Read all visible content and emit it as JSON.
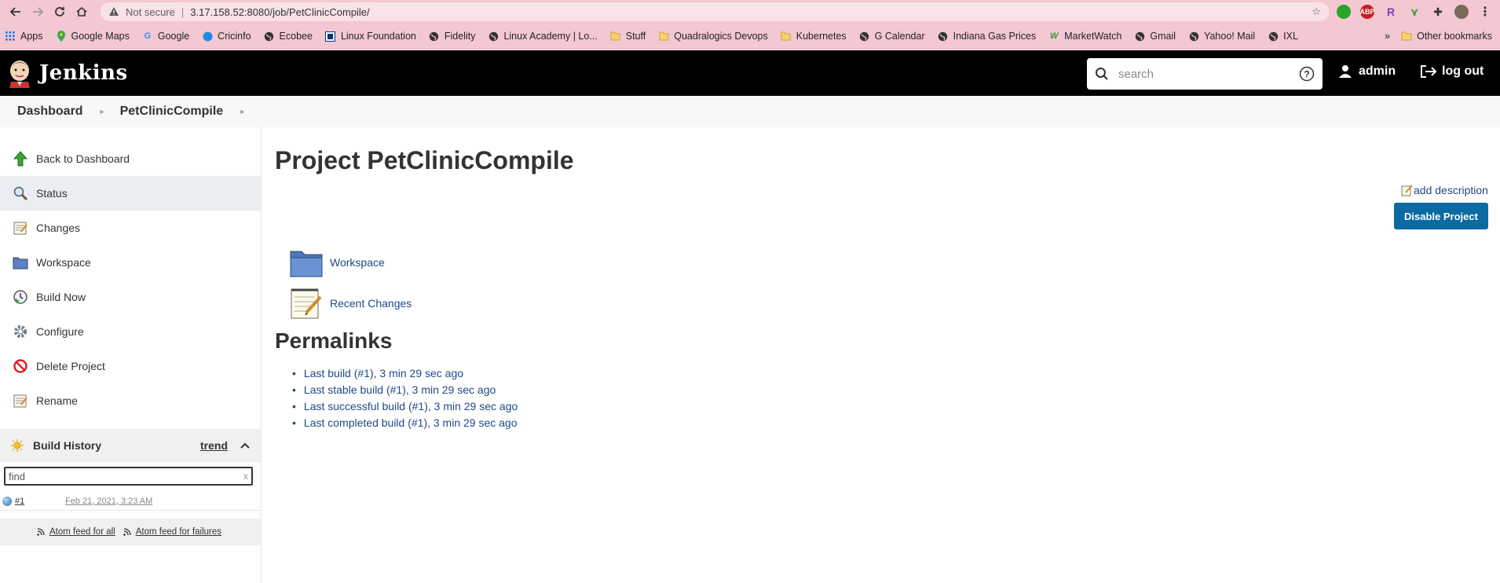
{
  "browser": {
    "security_label": "Not secure",
    "url_separator": "|",
    "url": "3.17.158.52:8080/job/PetClinicCompile/",
    "bookmarks": [
      {
        "label": "Apps",
        "icon": "apps-grid-icon"
      },
      {
        "label": "Google Maps",
        "icon": "maps-pin-icon"
      },
      {
        "label": "Google",
        "icon": "google-g-icon"
      },
      {
        "label": "Cricinfo",
        "icon": "cricinfo-icon"
      },
      {
        "label": "Ecobee",
        "icon": "globe-icon"
      },
      {
        "label": "Linux Foundation",
        "icon": "linux-foundation-icon"
      },
      {
        "label": "Fidelity",
        "icon": "globe-icon"
      },
      {
        "label": "Linux Academy | Lo...",
        "icon": "globe-icon"
      },
      {
        "label": "Stuff",
        "icon": "folder-icon"
      },
      {
        "label": "Quadralogics Devops",
        "icon": "folder-icon"
      },
      {
        "label": "Kubernetes",
        "icon": "folder-icon"
      },
      {
        "label": "G Calendar",
        "icon": "globe-icon"
      },
      {
        "label": "Indiana Gas Prices",
        "icon": "globe-icon"
      },
      {
        "label": "MarketWatch",
        "icon": "marketwatch-icon"
      },
      {
        "label": "Gmail",
        "icon": "globe-icon"
      },
      {
        "label": "Yahoo! Mail",
        "icon": "globe-icon"
      },
      {
        "label": "IXL",
        "icon": "globe-icon"
      }
    ],
    "more_bookmarks": "»",
    "other_bookmarks": "Other bookmarks",
    "extensions": [
      {
        "name": "green-extension-icon",
        "text": "",
        "color": "#2aa52a"
      },
      {
        "name": "adblock-plus-icon",
        "text": "ABP",
        "color": "#c41e1e"
      },
      {
        "name": "r-extension-icon",
        "text": "R",
        "color": "#7b3fb8"
      },
      {
        "name": "sprout-extension-icon",
        "text": "",
        "color": "#3a9a3a"
      }
    ]
  },
  "header": {
    "app_name": "Jenkins",
    "search_placeholder": "search",
    "user": "admin",
    "logout": "log out"
  },
  "breadcrumb": {
    "items": [
      "Dashboard",
      "PetClinicCompile"
    ]
  },
  "sidebar": {
    "tasks": [
      {
        "label": "Back to Dashboard",
        "icon": "up-arrow-icon"
      },
      {
        "label": "Status",
        "icon": "magnifier-icon"
      },
      {
        "label": "Changes",
        "icon": "notepad-icon"
      },
      {
        "label": "Workspace",
        "icon": "folder-icon"
      },
      {
        "label": "Build Now",
        "icon": "clock-play-icon"
      },
      {
        "label": "Configure",
        "icon": "gear-icon"
      },
      {
        "label": "Delete Project",
        "icon": "no-entry-icon"
      },
      {
        "label": "Rename",
        "icon": "notepad-icon"
      }
    ],
    "build_history": {
      "title": "Build History",
      "trend": "trend",
      "find_placeholder": "find",
      "clear": "x",
      "builds": [
        {
          "number": "#1",
          "date": "Feb 21, 2021, 3:23 AM"
        }
      ],
      "atom_all": "Atom feed for all",
      "atom_failures": "Atom feed for failures"
    }
  },
  "main": {
    "title": "Project PetClinicCompile",
    "add_description": "add description",
    "disable_button": "Disable Project",
    "links": [
      {
        "label": "Workspace",
        "icon": "folder-icon"
      },
      {
        "label": "Recent Changes",
        "icon": "notepad-icon"
      }
    ],
    "permalinks_title": "Permalinks",
    "permalinks": [
      "Last build (#1), 3 min 29 sec ago",
      "Last stable build (#1), 3 min 29 sec ago",
      "Last successful build (#1), 3 min 29 sec ago",
      "Last completed build (#1), 3 min 29 sec ago"
    ]
  }
}
